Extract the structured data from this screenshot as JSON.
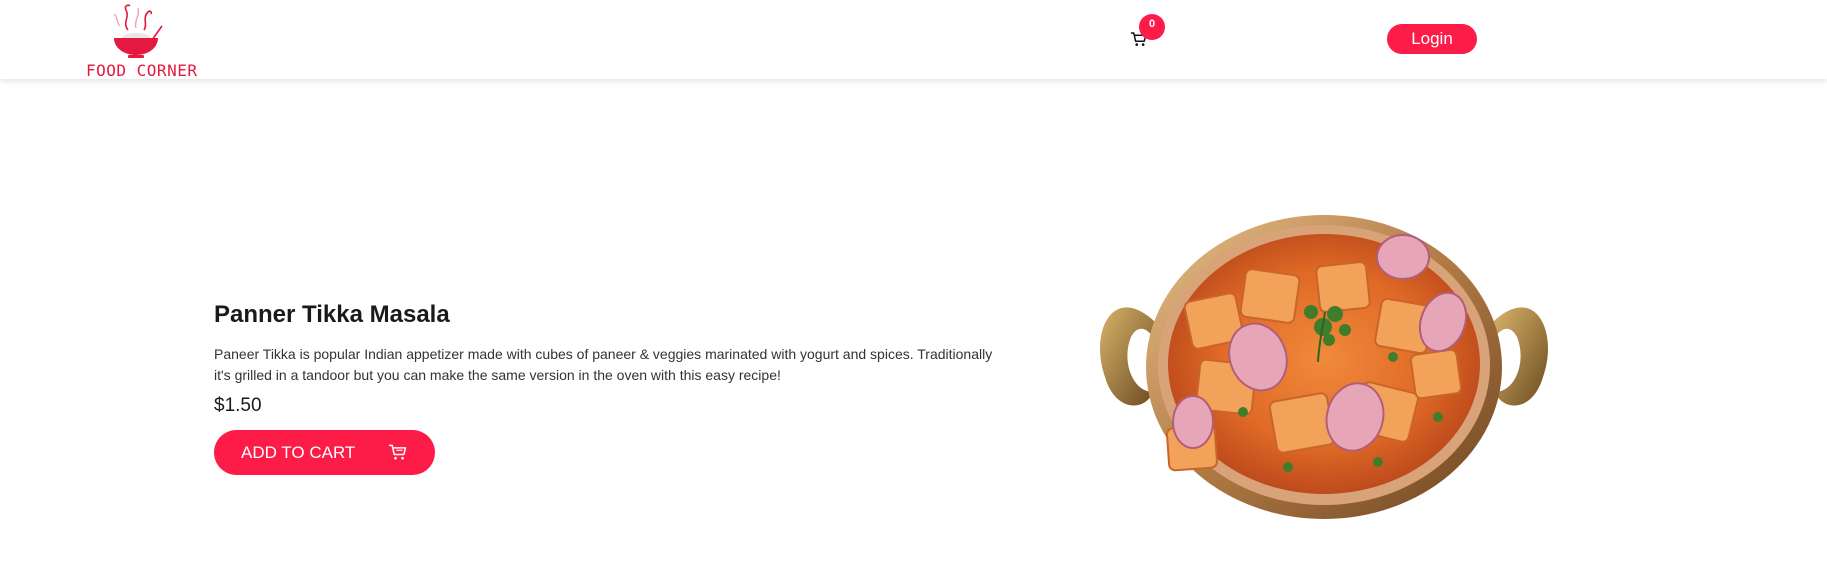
{
  "header": {
    "logo_text": "FOOD CORNER",
    "cart": {
      "icon": "cart-icon",
      "count": "0"
    },
    "login_label": "Login"
  },
  "product": {
    "title": "Panner Tikka Masala",
    "description": "Paneer Tikka is popular Indian appetizer made with cubes of paneer & veggies marinated with yogurt and spices. Traditionally it's grilled in a tandoor but you can make the same version in the oven with this easy recipe!",
    "price": "$1.50",
    "add_to_cart_label": "ADD TO CART",
    "add_to_cart_icon": "cart-icon",
    "image": "paneer-tikka-masala-dish"
  },
  "colors": {
    "accent": "#fd1b48",
    "logo_red": "#e5193f",
    "text": "#1a1a1a"
  }
}
